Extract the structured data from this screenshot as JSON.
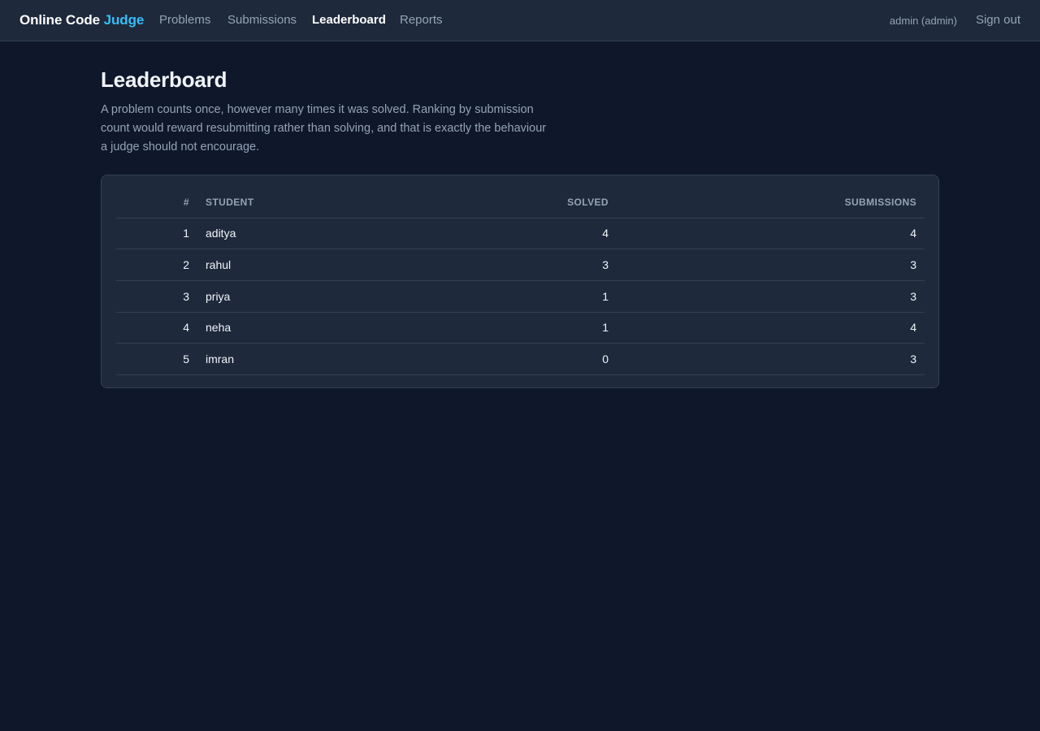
{
  "nav": {
    "brand_main": "Online Code ",
    "brand_accent": "Judge",
    "links": [
      "Problems",
      "Submissions",
      "Leaderboard",
      "Reports"
    ],
    "active": "Leaderboard",
    "user": "admin (admin)",
    "signout": "Sign out",
    "accent_color": "#38bdf8"
  },
  "page": {
    "title": "Leaderboard",
    "description": "A problem counts once, however many times it was solved. Ranking by submission count would reward resubmitting rather than solving, and that is exactly the behaviour a judge should not encourage."
  },
  "table": {
    "headers": {
      "rank": "#",
      "student": "STUDENT",
      "solved": "SOLVED",
      "submissions": "SUBMISSIONS"
    },
    "rows": [
      {
        "rank": "1",
        "student": "aditya",
        "solved": "4",
        "submissions": "4"
      },
      {
        "rank": "2",
        "student": "rahul",
        "solved": "3",
        "submissions": "3"
      },
      {
        "rank": "3",
        "student": "priya",
        "solved": "1",
        "submissions": "3"
      },
      {
        "rank": "4",
        "student": "neha",
        "solved": "1",
        "submissions": "4"
      },
      {
        "rank": "5",
        "student": "imran",
        "solved": "0",
        "submissions": "3"
      }
    ]
  }
}
